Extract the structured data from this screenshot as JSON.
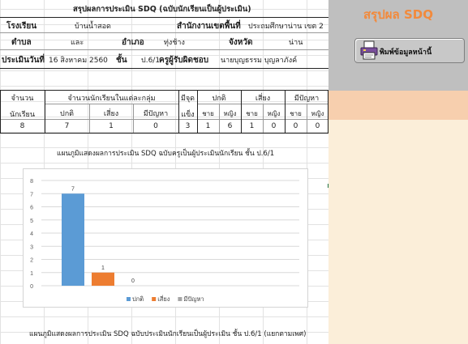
{
  "sheet": {
    "title": "สรุปผลการประเมิน SDQ  (ฉบับนักเรียนเป็นผู้ประเมิน)",
    "school_label": "โรงเรียน",
    "school_value": "บ้านน้ำสอด",
    "office_label": "สำนักงานเขตพื้นที่",
    "office_value": "ประถมศึกษาน่าน เขต 2",
    "subdistrict_label": "ตำบล",
    "subdistrict_value": "และ",
    "district_label": "อำเภอ",
    "district_value": "ทุ่งช้าง",
    "province_label": "จังหวัด",
    "province_value": "น่าน",
    "date_label": "ประเมินวันที่",
    "date_value": "16 สิงหาคม 2560",
    "class_label": "ชั้น",
    "class_value": "ป.6/1",
    "teacher_label": "ครูผู้รับผิดชอบ",
    "teacher_value": "นายบุญธรรม  บุญลาภังค์"
  },
  "summary_table": {
    "h_count_1": "จำนวน",
    "h_count_2": "นักเรียน",
    "h_groups": "จำนวนนักเรียนในแต่ละกลุ่ม",
    "h_normal": "ปกติ",
    "h_risk": "เสี่ยง",
    "h_problem": "มีปัญหา",
    "h_strength_1": "มีจุด",
    "h_strength_2": "แข็ง",
    "h_male": "ชาย",
    "h_female": "หญิง",
    "total": "8",
    "normal": "7",
    "risk": "1",
    "problem": "0",
    "strength": "3",
    "normal_m": "1",
    "normal_f": "6",
    "risk_m": "1",
    "risk_f": "0",
    "problem_m": "0",
    "problem_f": "0"
  },
  "chart_data": {
    "type": "bar",
    "title": "แผนภูมิแสดงผลการประเมิน SDQ ฉบับครูเป็นผู้ประเมินนักเรียน ชั้น ป.6/1",
    "categories": [
      "ปกติ",
      "เสี่ยง",
      "มีปัญหา"
    ],
    "series": [
      {
        "name": "ปกติ",
        "values": [
          7
        ],
        "color": "#5b9bd5"
      },
      {
        "name": "เสี่ยง",
        "values": [
          1
        ],
        "color": "#ed7d31"
      },
      {
        "name": "มีปัญหา",
        "values": [
          0
        ],
        "color": "#a5a5a5"
      }
    ],
    "y_ticks": [
      "0",
      "1",
      "2",
      "3",
      "4",
      "5",
      "6",
      "7",
      "8"
    ],
    "ylim": [
      0,
      8
    ],
    "grid": true,
    "legend": "bottom"
  },
  "second_chart_title": "แผนภูมิแสดงผลการประเมิน SDQ ฉบับประเมินนักเรียนเป็นผู้ประเมิน ชั้น ป.6/1 (แยกตามเพศ)",
  "panel": {
    "title": "สรุปผล SDQ",
    "print_button": "พิมพ์ข้อมูลหน้านี้",
    "print_icon": "printer-icon"
  }
}
